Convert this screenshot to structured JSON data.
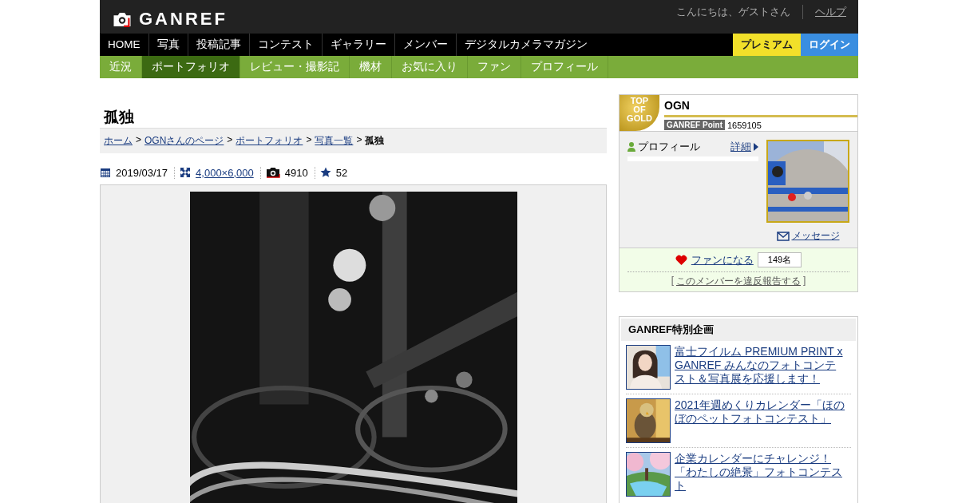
{
  "header": {
    "logo": "GANREF",
    "greeting": "こんにちは、ゲストさん",
    "help_link": "ヘルプ"
  },
  "nav": {
    "items": [
      {
        "label": "HOME"
      },
      {
        "label": "写真"
      },
      {
        "label": "投稿記事"
      },
      {
        "label": "コンテスト"
      },
      {
        "label": "ギャラリー"
      },
      {
        "label": "メンバー"
      },
      {
        "label": "デジタルカメラマガジン"
      }
    ],
    "premium": "プレミアム",
    "login": "ログイン"
  },
  "subnav": [
    {
      "label": "近況",
      "selected": false
    },
    {
      "label": "ポートフォリオ",
      "selected": true
    },
    {
      "label": "レビュー・撮影記",
      "selected": false
    },
    {
      "label": "機材",
      "selected": false
    },
    {
      "label": "お気に入り",
      "selected": false
    },
    {
      "label": "ファン",
      "selected": false
    },
    {
      "label": "プロフィール",
      "selected": false
    }
  ],
  "photo": {
    "title": "孤独",
    "breadcrumb": [
      {
        "label": "ホーム",
        "kind": "link"
      },
      {
        "label": ">",
        "kind": "separator"
      },
      {
        "label": "OGNさんのページ",
        "kind": "link"
      },
      {
        "label": ">",
        "kind": "separator"
      },
      {
        "label": "ポートフォリオ",
        "kind": "link"
      },
      {
        "label": ">",
        "kind": "separator"
      },
      {
        "label": "写真一覧",
        "kind": "link"
      },
      {
        "label": ">",
        "kind": "separator"
      },
      {
        "label": "孤独",
        "kind": "current"
      }
    ],
    "date": "2019/03/17",
    "size": "4,000×6,000",
    "views": "4910",
    "favorites": "52",
    "kind": "picture"
  },
  "member": {
    "badge": "TOP\nOF\nGOLD",
    "name": "OGN",
    "point_label": "GANREF Point",
    "points": "1659105",
    "profile_label": "プロフィール",
    "detail_link": "詳細",
    "message_link": "メッセージ",
    "fan_link": "ファンになる",
    "fan_count": "149名",
    "report_open": "[",
    "report_link": "このメンバーを違反報告する",
    "report_close": "]"
  },
  "special": {
    "title": "GANREF特別企画",
    "items": [
      {
        "text": "富士フイルム PREMIUM PRINT x GANREF みんなのフォトコンテスト＆写真展を応援します！"
      },
      {
        "text": "2021年週めくりカレンダー「ほのぼのペットフォトコンテスト」"
      },
      {
        "text": "企業カレンダーにチャレンジ！「わたしの絶景」フォトコンテスト"
      }
    ]
  }
}
